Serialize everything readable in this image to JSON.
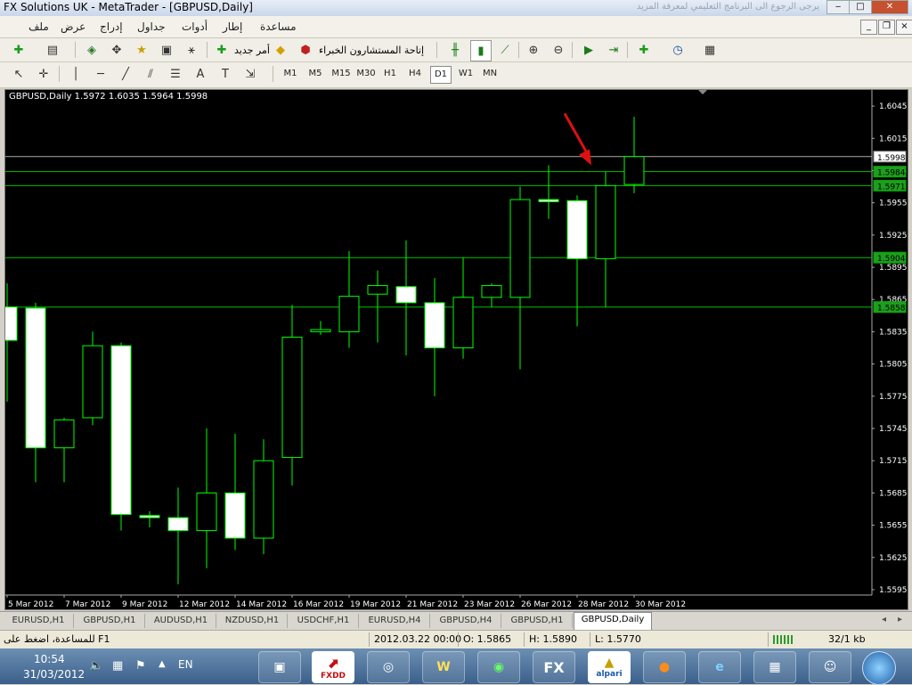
{
  "window": {
    "title": "FX Solutions UK - MetaTrader - [GBPUSD,Daily]",
    "banner": "يرجى الرجوع الى البرنامج التعليمي لمعرفة المزيد"
  },
  "menu": {
    "items": [
      "ملف",
      "عرض",
      "إدراج",
      "جداول",
      "أدوات",
      "إطار",
      "مساعدة"
    ]
  },
  "toolbar": {
    "new_order": "أمر جديد",
    "experts": "إتاحة المستشارون الخبراء",
    "periods": [
      "M1",
      "M5",
      "M15",
      "M30",
      "H1",
      "H4",
      "D1",
      "W1",
      "MN"
    ],
    "active_period": "D1"
  },
  "chart": {
    "header": "GBPUSD,Daily  1.5972 1.6035 1.5964 1.5998",
    "price_labels": [
      "1.6045",
      "1.6015",
      "1.5985",
      "1.5955",
      "1.5925",
      "1.5895",
      "1.5865",
      "1.5835",
      "1.5805",
      "1.5775",
      "1.5745",
      "1.5715",
      "1.5685",
      "1.5655",
      "1.5625",
      "1.5595"
    ],
    "date_labels": [
      "5 Mar 2012",
      "7 Mar 2012",
      "9 Mar 2012",
      "12 Mar 2012",
      "14 Mar 2012",
      "16 Mar 2012",
      "19 Mar 2012",
      "21 Mar 2012",
      "23 Mar 2012",
      "26 Mar 2012",
      "28 Mar 2012",
      "30 Mar 2012"
    ],
    "level_labels": [
      {
        "value": 1.5998,
        "text": "1.5998",
        "kind": "current"
      },
      {
        "value": 1.5984,
        "text": "1.5984",
        "kind": "level"
      },
      {
        "value": 1.5971,
        "text": "1.5971",
        "kind": "level"
      },
      {
        "value": 1.5904,
        "text": "1.5904",
        "kind": "level"
      },
      {
        "value": 1.5858,
        "text": "1.5858",
        "kind": "level"
      }
    ],
    "colors": {
      "background": "#000000",
      "candle_up": "#000000",
      "candle_down": "#ffffff",
      "wick": "#00ff00",
      "level": "#00c000",
      "bid": "#aaaaaa",
      "arrow": "#e01010"
    }
  },
  "chart_data": {
    "type": "candlestick",
    "ylim": [
      1.559,
      1.606
    ],
    "candles": [
      {
        "o": 1.5858,
        "h": 1.588,
        "l": 1.577,
        "c": 1.5827
      },
      {
        "o": 1.5857,
        "h": 1.5862,
        "l": 1.5695,
        "c": 1.5727
      },
      {
        "o": 1.5727,
        "h": 1.5755,
        "l": 1.5695,
        "c": 1.5753
      },
      {
        "o": 1.5755,
        "h": 1.5835,
        "l": 1.5748,
        "c": 1.5822
      },
      {
        "o": 1.5822,
        "h": 1.5825,
        "l": 1.565,
        "c": 1.5665
      },
      {
        "o": 1.5664,
        "h": 1.5668,
        "l": 1.5653,
        "c": 1.5662
      },
      {
        "o": 1.5662,
        "h": 1.569,
        "l": 1.56,
        "c": 1.565
      },
      {
        "o": 1.565,
        "h": 1.5745,
        "l": 1.5615,
        "c": 1.5685
      },
      {
        "o": 1.5685,
        "h": 1.574,
        "l": 1.5632,
        "c": 1.5643
      },
      {
        "o": 1.5643,
        "h": 1.5735,
        "l": 1.5628,
        "c": 1.5715
      },
      {
        "o": 1.5718,
        "h": 1.586,
        "l": 1.5692,
        "c": 1.583
      },
      {
        "o": 1.5835,
        "h": 1.5845,
        "l": 1.5832,
        "c": 1.5837
      },
      {
        "o": 1.5835,
        "h": 1.591,
        "l": 1.582,
        "c": 1.5868
      },
      {
        "o": 1.587,
        "h": 1.5892,
        "l": 1.5825,
        "c": 1.5878
      },
      {
        "o": 1.5877,
        "h": 1.592,
        "l": 1.5813,
        "c": 1.5862
      },
      {
        "o": 1.5862,
        "h": 1.5885,
        "l": 1.5775,
        "c": 1.582
      },
      {
        "o": 1.582,
        "h": 1.5904,
        "l": 1.581,
        "c": 1.5867
      },
      {
        "o": 1.5867,
        "h": 1.588,
        "l": 1.5858,
        "c": 1.5878
      },
      {
        "o": 1.5867,
        "h": 1.597,
        "l": 1.58,
        "c": 1.5958
      },
      {
        "o": 1.5958,
        "h": 1.599,
        "l": 1.594,
        "c": 1.5956
      },
      {
        "o": 1.5957,
        "h": 1.5962,
        "l": 1.584,
        "c": 1.5903
      },
      {
        "o": 1.5903,
        "h": 1.5984,
        "l": 1.5858,
        "c": 1.5971
      },
      {
        "o": 1.5972,
        "h": 1.6035,
        "l": 1.5964,
        "c": 1.5998
      }
    ]
  },
  "tabs": [
    "EURUSD,H1",
    "GBPUSD,H1",
    "AUDUSD,H1",
    "NZDUSD,H1",
    "USDCHF,H1",
    "EURUSD,H4",
    "GBPUSD,H4",
    "GBPUSD,H1",
    "GBPUSD,Daily"
  ],
  "active_tab": "GBPUSD,Daily",
  "status": {
    "help": "للمساعدة، اضغط على F1",
    "datetime": "2012.03.22 00:00",
    "open": "O: 1.5865",
    "high": "H: 1.5890",
    "low": "L: 1.5770",
    "traffic": "32/1 kb"
  },
  "taskbar": {
    "time": "10:54",
    "date": "31/03/2012",
    "lang": "EN",
    "apps": [
      "FXDD",
      "FX",
      "alpari"
    ]
  }
}
